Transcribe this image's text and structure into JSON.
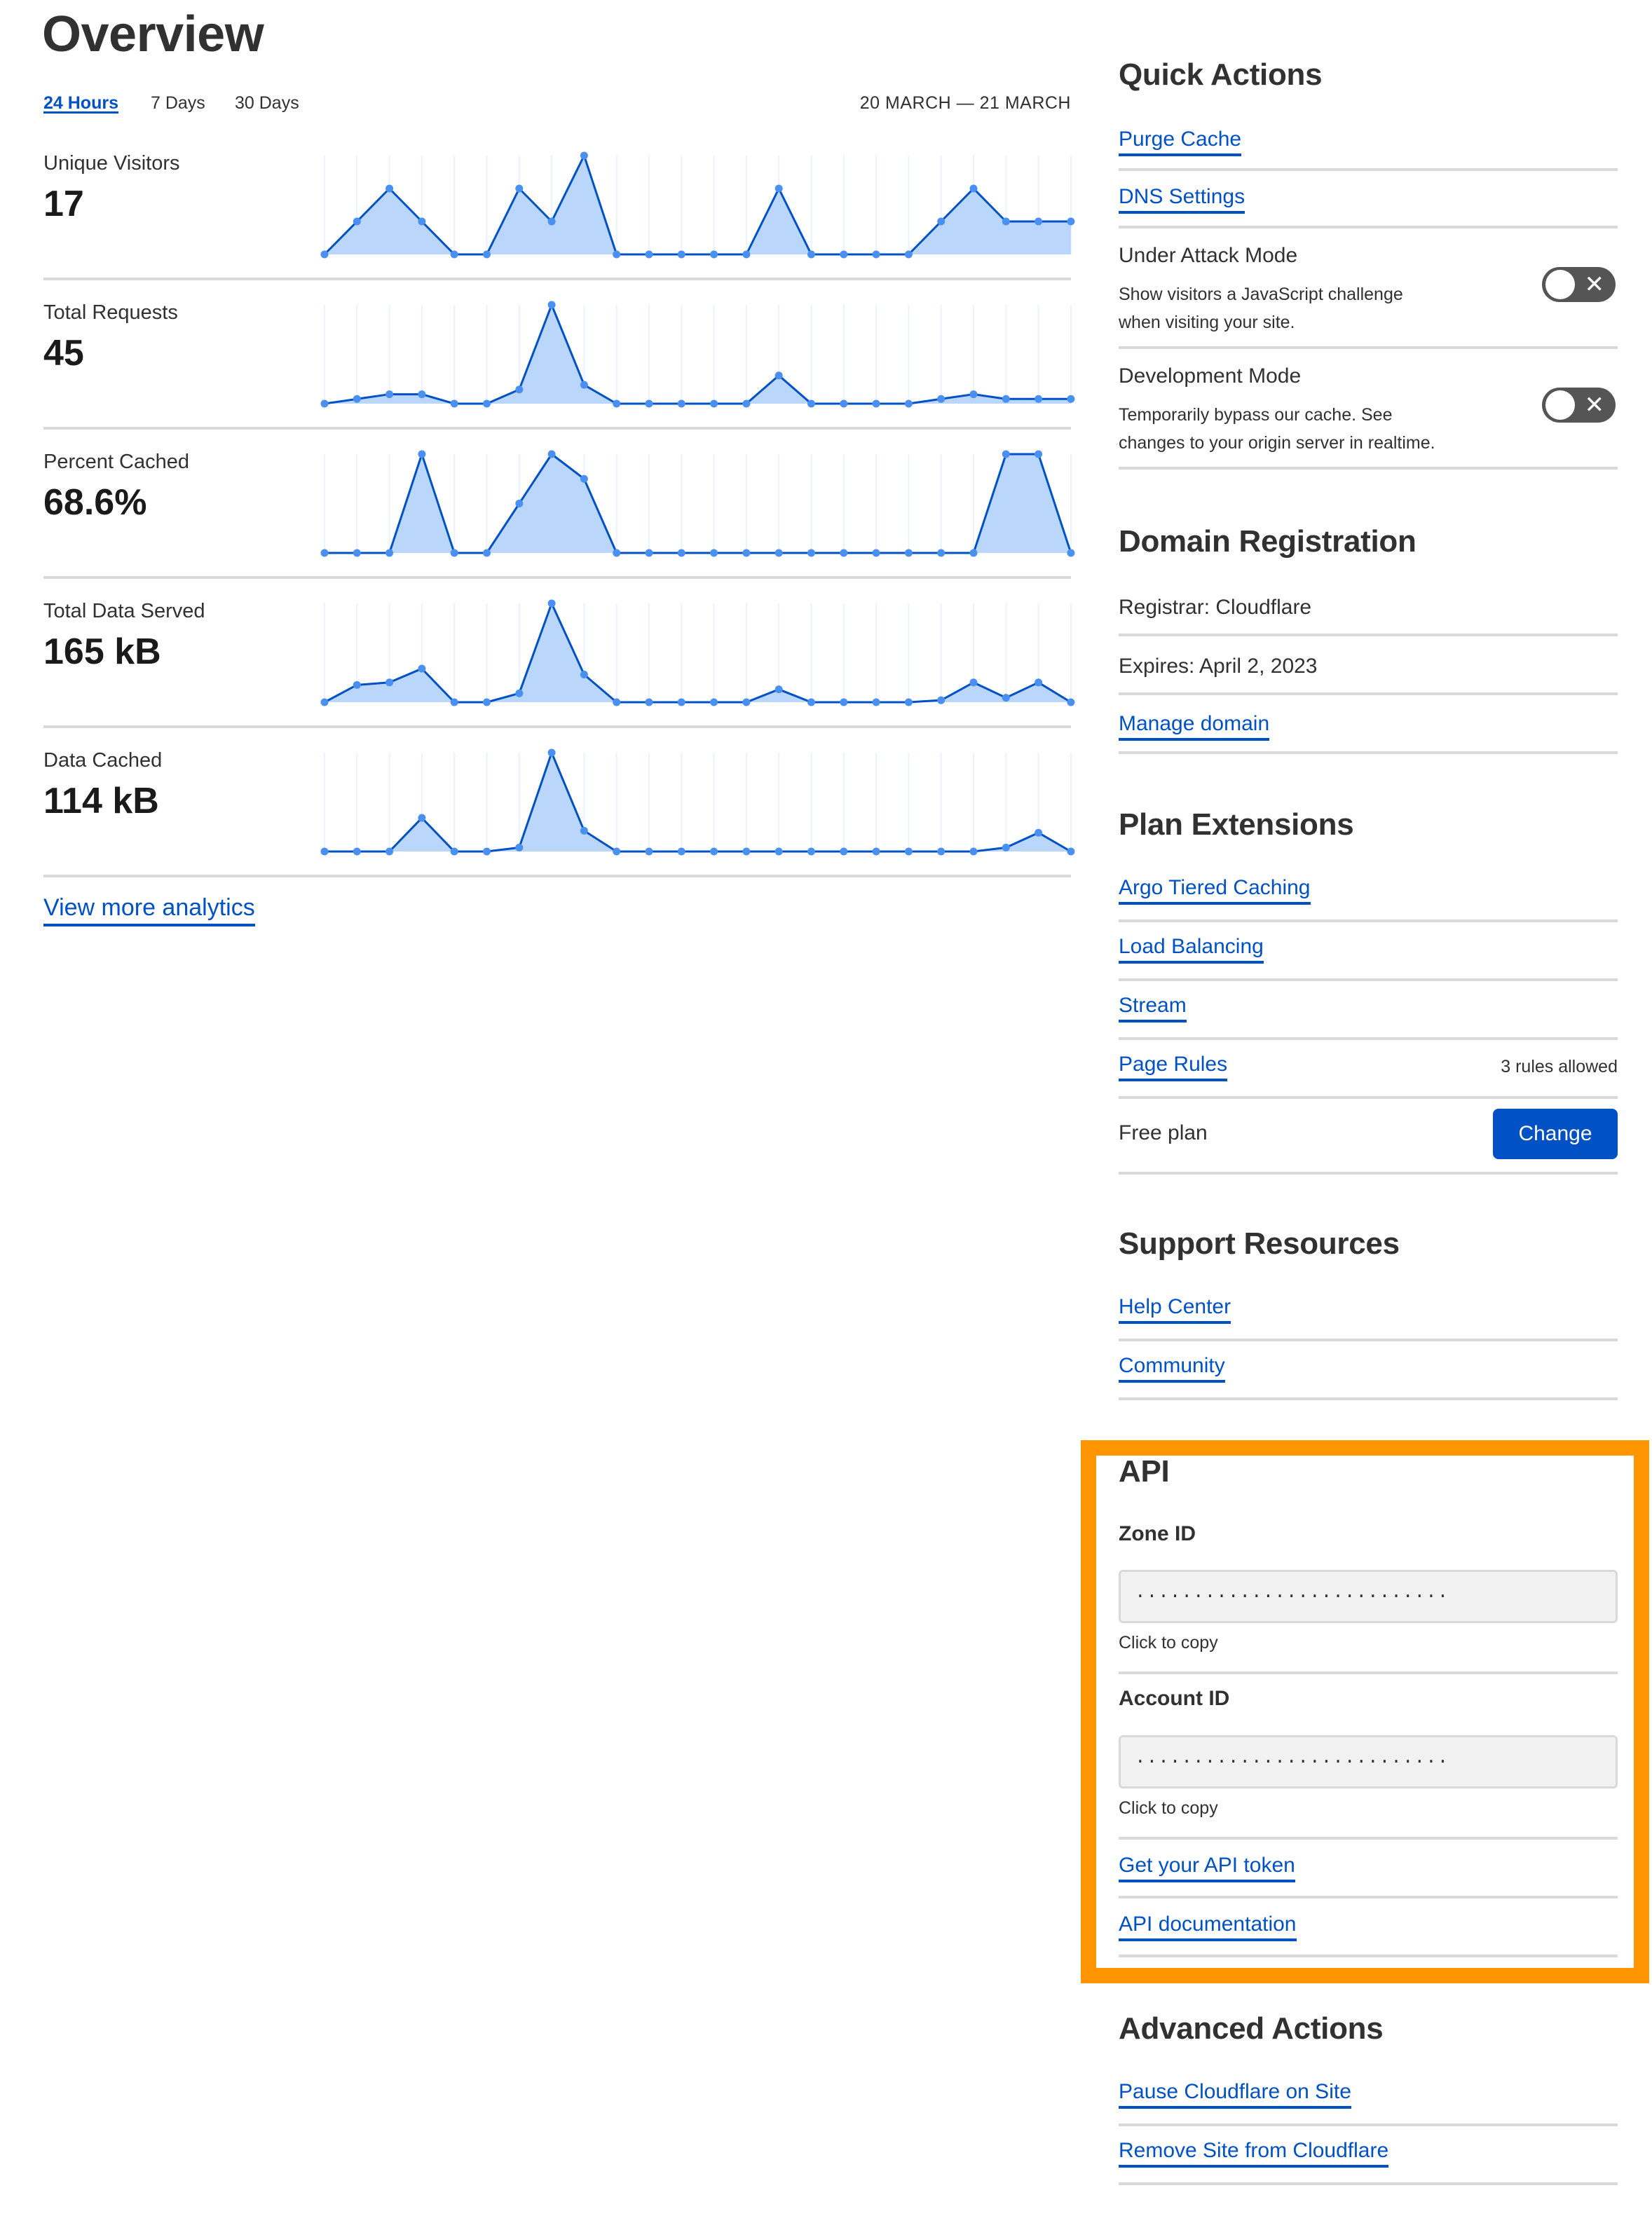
{
  "overview": {
    "title": "Overview",
    "ranges": [
      {
        "label": "24 Hours",
        "active": true
      },
      {
        "label": "7 Days",
        "active": false
      },
      {
        "label": "30 Days",
        "active": false
      }
    ],
    "date_range": "20 MARCH — 21 MARCH",
    "view_more_label": "View more analytics"
  },
  "colors": {
    "link": "#0051c3",
    "line": "#0051c3",
    "fill": "#bad6fb",
    "dot": "#4a90f0",
    "gridline": "#eaf2fd",
    "highlight_border": "#ff9500",
    "toggle_off": "#555555"
  },
  "chart_data": [
    {
      "type": "area",
      "title": "Unique Visitors",
      "summary": "17",
      "x": [
        0,
        1,
        2,
        3,
        4,
        5,
        6,
        7,
        8,
        9,
        10,
        11,
        12,
        13,
        14,
        15,
        16,
        17,
        18,
        19,
        20,
        21,
        22,
        23
      ],
      "values": [
        0,
        1,
        2,
        1,
        0,
        0,
        2,
        1,
        3,
        0,
        0,
        0,
        0,
        0,
        2,
        0,
        0,
        0,
        0,
        1,
        2,
        1,
        1,
        1
      ],
      "ylim": [
        0,
        3
      ]
    },
    {
      "type": "area",
      "title": "Total Requests",
      "summary": "45",
      "x": [
        0,
        1,
        2,
        3,
        4,
        5,
        6,
        7,
        8,
        9,
        10,
        11,
        12,
        13,
        14,
        15,
        16,
        17,
        18,
        19,
        20,
        21,
        22,
        23
      ],
      "values": [
        0,
        1,
        2,
        2,
        0,
        0,
        3,
        21,
        4,
        0,
        0,
        0,
        0,
        0,
        6,
        0,
        0,
        0,
        0,
        1,
        2,
        1,
        1,
        1
      ],
      "ylim": [
        0,
        21
      ]
    },
    {
      "type": "area",
      "title": "Percent Cached",
      "summary": "68.6%",
      "x": [
        0,
        1,
        2,
        3,
        4,
        5,
        6,
        7,
        8,
        9,
        10,
        11,
        12,
        13,
        14,
        15,
        16,
        17,
        18,
        19,
        20,
        21,
        22,
        23
      ],
      "values": [
        0,
        0,
        0,
        100,
        0,
        0,
        50,
        100,
        75,
        0,
        0,
        0,
        0,
        0,
        0,
        0,
        0,
        0,
        0,
        0,
        0,
        100,
        100,
        0
      ],
      "ylim": [
        0,
        100
      ]
    },
    {
      "type": "area",
      "title": "Total Data Served",
      "summary": "165 kB",
      "x": [
        0,
        1,
        2,
        3,
        4,
        5,
        6,
        7,
        8,
        9,
        10,
        11,
        12,
        13,
        14,
        15,
        16,
        17,
        18,
        19,
        20,
        21,
        22,
        23
      ],
      "values": [
        0,
        0.175,
        0.2,
        0.34,
        0,
        0,
        0.09,
        1.0,
        0.28,
        0,
        0,
        0,
        0,
        0,
        0.13,
        0,
        0,
        0,
        0,
        0.02,
        0.2,
        0.045,
        0.2,
        0
      ],
      "ylim": [
        0,
        1
      ]
    },
    {
      "type": "area",
      "title": "Data Cached",
      "summary": "114 kB",
      "x": [
        0,
        1,
        2,
        3,
        4,
        5,
        6,
        7,
        8,
        9,
        10,
        11,
        12,
        13,
        14,
        15,
        16,
        17,
        18,
        19,
        20,
        21,
        22,
        23
      ],
      "values": [
        0,
        0,
        0,
        0.34,
        0,
        0,
        0.04,
        1.0,
        0.21,
        0,
        0,
        0,
        0,
        0,
        0,
        0,
        0,
        0,
        0,
        0,
        0,
        0.04,
        0.19,
        0
      ],
      "ylim": [
        0,
        1
      ]
    }
  ],
  "quick_actions": {
    "heading": "Quick Actions",
    "links": [
      "Purge Cache",
      "DNS Settings"
    ],
    "toggles": [
      {
        "title": "Under Attack Mode",
        "desc_line1": "Show visitors a JavaScript challenge",
        "desc_line2": "when visiting your site.",
        "enabled": false,
        "icon": "x-icon"
      },
      {
        "title": "Development Mode",
        "desc_line1": "Temporarily bypass our cache. See",
        "desc_line2": "changes to your origin server in realtime.",
        "enabled": false,
        "icon": "x-icon"
      }
    ],
    "toggle_glyph": "✕"
  },
  "domain_registration": {
    "heading": "Domain Registration",
    "registrar": "Registrar: Cloudflare",
    "expires": "Expires: April 2, 2023",
    "manage_link": "Manage domain"
  },
  "plan_extensions": {
    "heading": "Plan Extensions",
    "links": [
      "Argo Tiered Caching",
      "Load Balancing",
      "Stream",
      "Page Rules"
    ],
    "page_rules_note": "3 rules allowed",
    "plan_label": "Free plan",
    "change_button": "Change"
  },
  "support": {
    "heading": "Support Resources",
    "links": [
      "Help Center",
      "Community"
    ]
  },
  "api": {
    "heading": "API",
    "zone_id_label": "Zone ID",
    "zone_id_value": "...........................",
    "account_id_label": "Account ID",
    "account_id_value": "...........................",
    "copy_hint": "Click to copy",
    "links": [
      "Get your API token",
      "API documentation"
    ]
  },
  "advanced": {
    "heading": "Advanced Actions",
    "links": [
      "Pause Cloudflare on Site",
      "Remove Site from Cloudflare"
    ]
  }
}
